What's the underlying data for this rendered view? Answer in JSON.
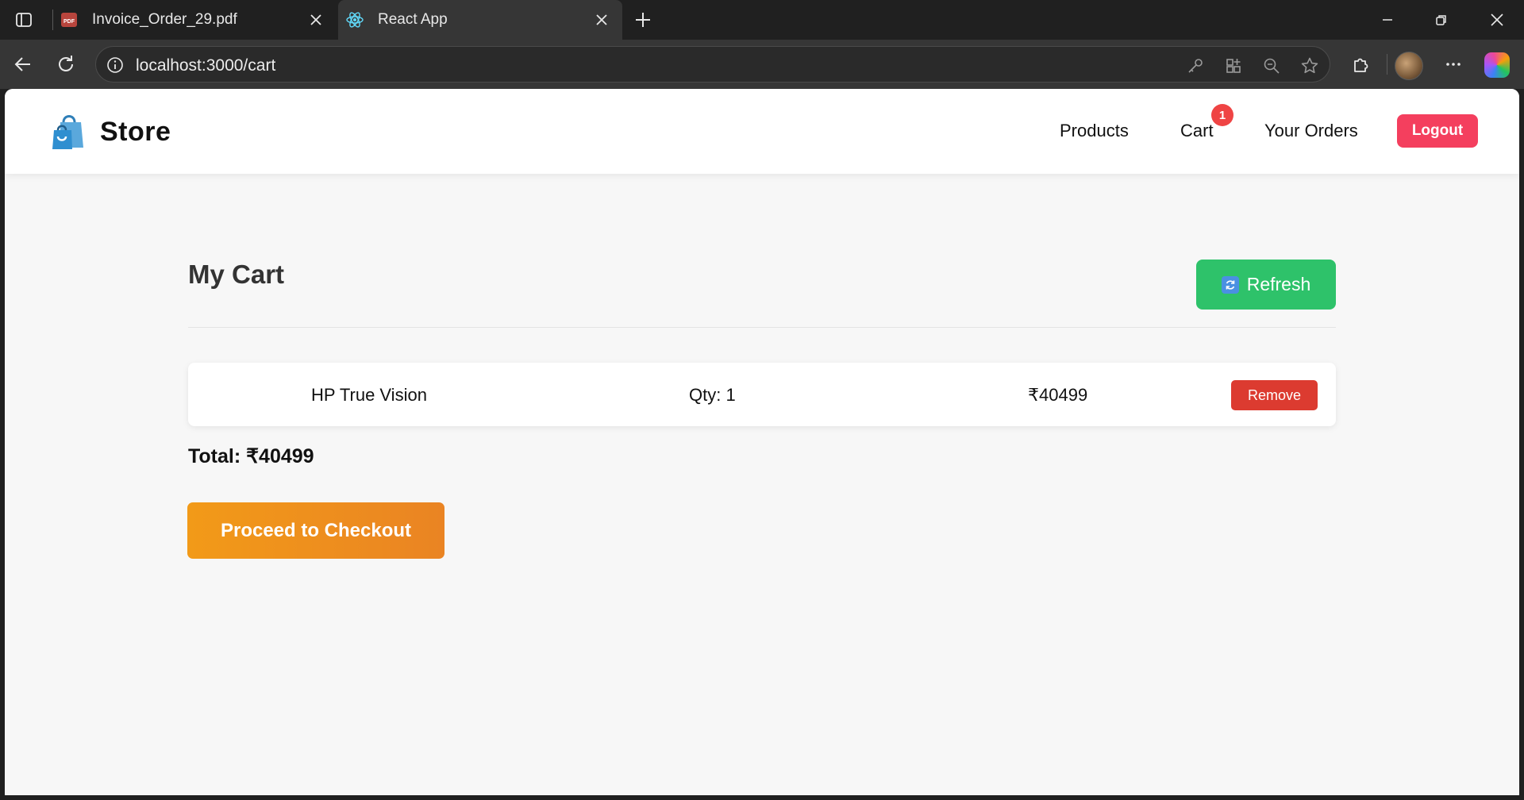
{
  "browser": {
    "tabs": [
      {
        "title": "Invoice_Order_29.pdf",
        "favicon": "pdf-icon",
        "active": false
      },
      {
        "title": "React App",
        "favicon": "react-icon",
        "active": true
      }
    ],
    "pdf_favicon_label": "PDF",
    "url": "localhost:3000/cart"
  },
  "navbar": {
    "brand": "Store",
    "links": {
      "products": "Products",
      "cart": "Cart",
      "orders": "Your Orders"
    },
    "cart_count": "1",
    "logout_label": "Logout"
  },
  "cart": {
    "title": "My Cart",
    "refresh_label": "Refresh",
    "items": [
      {
        "name": "HP True Vision",
        "qty": "Qty: 1",
        "price": "₹40499",
        "remove_label": "Remove"
      }
    ],
    "total": "Total: ₹40499",
    "checkout_label": "Proceed to Checkout"
  },
  "colors": {
    "logout": "#f43f5e",
    "refresh": "#2ec26a",
    "remove": "#dc3b30",
    "checkout": "#f29a18",
    "badge": "#ef4444"
  }
}
